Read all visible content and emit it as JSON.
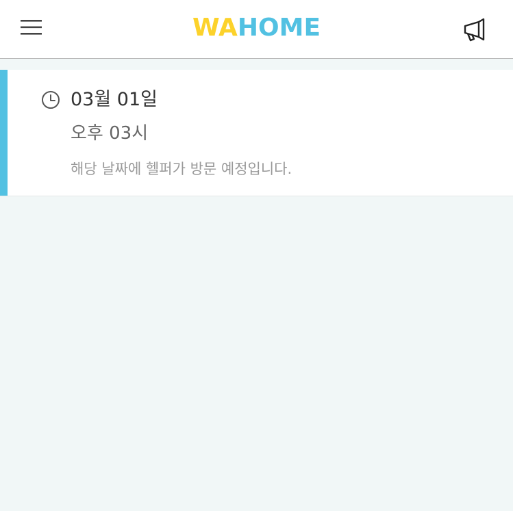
{
  "header": {
    "logo_part1": "WA",
    "logo_part2": "HOME",
    "menu_icon": "hamburger-menu-icon",
    "notice_icon": "megaphone-icon"
  },
  "visit": {
    "date": "03월 01일",
    "time": "오후 03시",
    "message": "해당 날짜에 헬퍼가 방문 예정입니다."
  },
  "colors": {
    "logo_yellow": "#fcd22b",
    "accent_blue": "#52c1e2",
    "background": "#f1f7f7"
  }
}
